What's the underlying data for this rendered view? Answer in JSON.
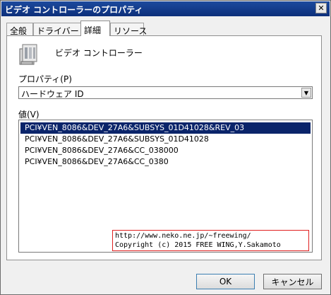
{
  "window": {
    "title": "ビデオ コントローラーのプロパティ",
    "close_label": "✕"
  },
  "tabs": [
    {
      "label": "全般"
    },
    {
      "label": "ドライバー"
    },
    {
      "label": "詳細",
      "active": true
    },
    {
      "label": "リソース"
    }
  ],
  "device": {
    "name": "ビデオ コントローラー",
    "icon": "device-icon"
  },
  "property": {
    "label": "プロパティ(P)",
    "selected": "ハードウェア ID"
  },
  "values": {
    "label": "値(V)",
    "items": [
      {
        "text": "PCI¥VEN_8086&DEV_27A6&SUBSYS_01D41028&REV_03",
        "selected": true
      },
      {
        "text": "PCI¥VEN_8086&DEV_27A6&SUBSYS_01D41028"
      },
      {
        "text": "PCI¥VEN_8086&DEV_27A6&CC_038000"
      },
      {
        "text": "PCI¥VEN_8086&DEV_27A6&CC_0380"
      }
    ]
  },
  "watermark": {
    "line1": "http://www.neko.ne.jp/~freewing/",
    "line2": "Copyright (c) 2015 FREE WING,Y.Sakamoto"
  },
  "buttons": {
    "ok": "OK",
    "cancel": "キャンセル"
  },
  "colors": {
    "titlebar": "#0c2f7a",
    "selection": "#0a246a",
    "watermark_border": "#e02020"
  }
}
